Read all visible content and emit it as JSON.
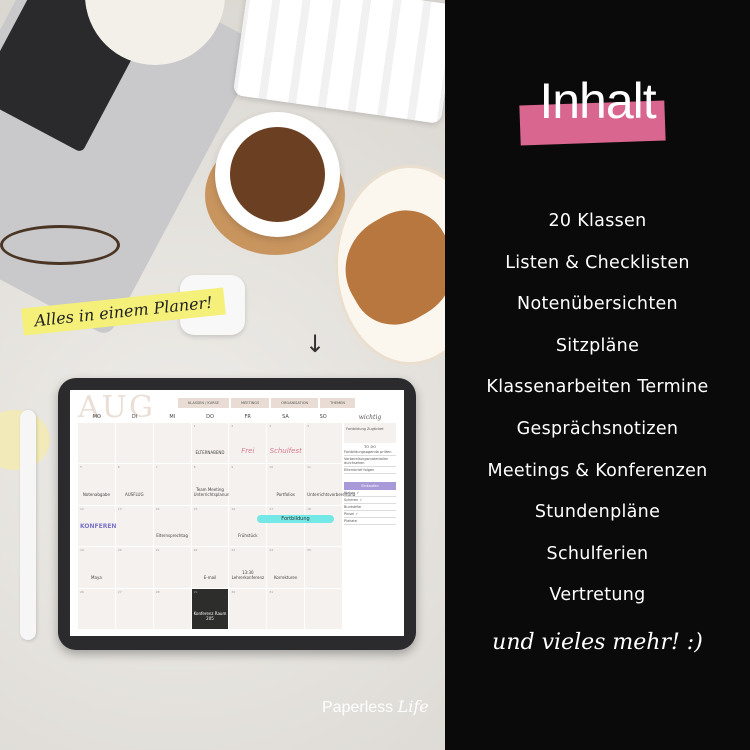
{
  "tagline": "Alles in einem Planer!",
  "brand": {
    "name": "Paperless",
    "name_italic": "Life"
  },
  "panel": {
    "title": "Inhalt",
    "accent_color": "#d8668e",
    "items": [
      "20 Klassen",
      "Listen & Checklisten",
      "Notenübersichten",
      "Sitzpläne",
      "Klassenarbeiten Termine",
      "Gesprächsnotizen",
      "Meetings & Konferenzen",
      "Stundenpläne",
      "Schulferien",
      "Vertretung"
    ],
    "more": "und vieles mehr! :)"
  },
  "planner": {
    "month": "AUG",
    "tabs": [
      "KLASSEN / KURSE",
      "MEETINGS",
      "ORGANISATION",
      "THEMEN"
    ],
    "weekdays": [
      "MO",
      "DI",
      "MI",
      "DO",
      "FR",
      "SA",
      "SO"
    ],
    "cells": [
      {
        "n": "",
        "t": ""
      },
      {
        "n": "",
        "t": ""
      },
      {
        "n": "",
        "t": ""
      },
      {
        "n": "1",
        "t": "ELTERNABEND"
      },
      {
        "n": "2",
        "t": "Frei",
        "cls": "big"
      },
      {
        "n": "3",
        "t": "Schulfest",
        "cls": "big"
      },
      {
        "n": "4",
        "t": ""
      },
      {
        "n": "5",
        "t": "Notenabgabe"
      },
      {
        "n": "6",
        "t": "AUSFLUG"
      },
      {
        "n": "7",
        "t": ""
      },
      {
        "n": "8",
        "t": "Team Meeting Unterrichtsplanung"
      },
      {
        "n": "9",
        "t": ""
      },
      {
        "n": "10",
        "t": "Portfolios"
      },
      {
        "n": "11",
        "t": "Unterrichtsvorbereitung"
      },
      {
        "n": "12",
        "t": "KONFERENZ",
        "cls": "kon"
      },
      {
        "n": "13",
        "t": ""
      },
      {
        "n": "14",
        "t": "Elternsprechtag"
      },
      {
        "n": "15",
        "t": ""
      },
      {
        "n": "16",
        "t": "Frühstück"
      },
      {
        "n": "17",
        "t": ""
      },
      {
        "n": "18",
        "t": ""
      },
      {
        "n": "19",
        "t": "Maya"
      },
      {
        "n": "20",
        "t": ""
      },
      {
        "n": "21",
        "t": ""
      },
      {
        "n": "22",
        "t": "E-mail"
      },
      {
        "n": "23",
        "t": "13:30 Lehrerkonferenz"
      },
      {
        "n": "24",
        "t": "Korrekturen"
      },
      {
        "n": "25",
        "t": ""
      },
      {
        "n": "26",
        "t": ""
      },
      {
        "n": "27",
        "t": ""
      },
      {
        "n": "28",
        "t": ""
      },
      {
        "n": "29",
        "t": "Konferenz Raum 205",
        "cls": "dark"
      },
      {
        "n": "30",
        "t": ""
      },
      {
        "n": "31",
        "t": ""
      },
      {
        "n": "",
        "t": ""
      }
    ],
    "event": "Fortbildung",
    "sidebar": {
      "heading": "wichtig",
      "note": "Fortbildung Zugticket",
      "todo_heading": "TO DO",
      "todos": [
        "Fortbildungsagenda prüfen",
        "Vorbereitungsmaterialien durchsehen",
        "Elternbrief folgen"
      ],
      "list_heading": "Einkaufen",
      "list": [
        "Kleber ✓",
        "Scheren ✓",
        "Buntstifte",
        "Pinsel ✓",
        "Plakate"
      ]
    }
  }
}
